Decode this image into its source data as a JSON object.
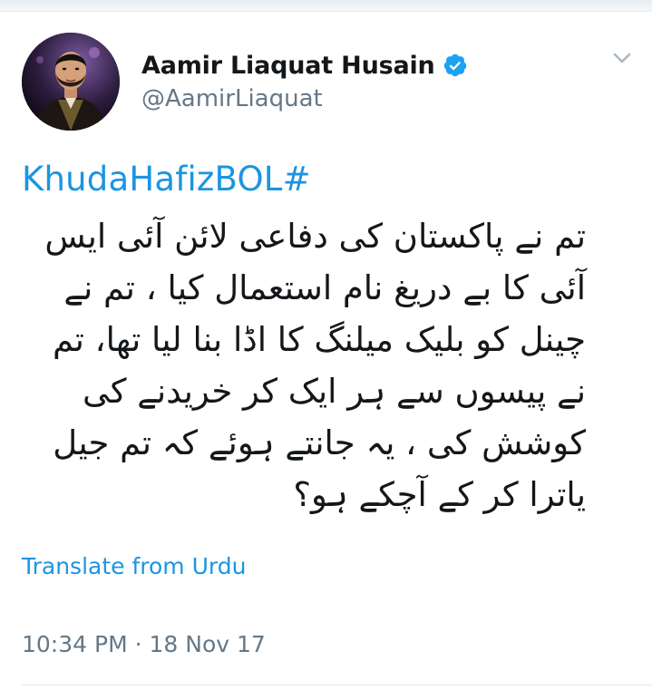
{
  "author": {
    "display_name": "Aamir Liaquat Husain",
    "handle": "@AamirLiaquat",
    "verified": true,
    "avatar_icon": "profile-photo",
    "verified_icon": "verified-badge-icon"
  },
  "tweet": {
    "hashtag": "KhudaHafizBOL#",
    "text": "تم نے پاکستان  کی دفاعی لائن آئی ایس آئی  کا بے دریغ نام  استعمال کیا ، تم نے چینل کو بلیک میلنگ کا اڈا بنا لیا تھا،  تم نے پیسوں سے ہر ایک کر خریدنے کی کوشش کی ، یہ  جانتے ہوئے کہ تم جیل یاترا کر کے آچکے ہو؟",
    "translate_label": "Translate from Urdu",
    "timestamp": "10:34 PM · 18 Nov 17"
  },
  "colors": {
    "link": "#1b95e0",
    "muted": "#657786",
    "text": "#14171a",
    "verified": "#1da1f2"
  },
  "icons": {
    "menu": "chevron-down-icon"
  }
}
